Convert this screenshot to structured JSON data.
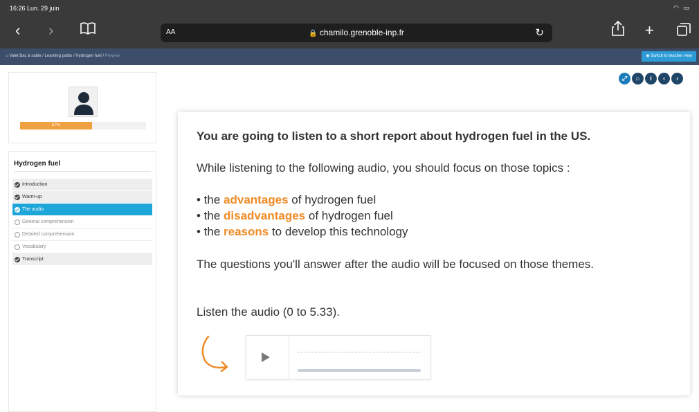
{
  "browser": {
    "status_time": "16:26  Lun. 29 juin",
    "address_aa": "AA",
    "url": "chamilo.grenoble-inp.fr"
  },
  "breadcrumb": {
    "items": [
      "Valet Bac à sable",
      "Learning paths",
      "Hydrogen fuel"
    ],
    "current": "Preview",
    "teacher_view_label": "Switch to teacher view"
  },
  "profile": {
    "progress_label": "57%",
    "progress_value": 0.57
  },
  "learning_path": {
    "title": "Hydrogen fuel",
    "items": [
      {
        "label": "Introduction",
        "state": "done"
      },
      {
        "label": "Warm-up",
        "state": "done"
      },
      {
        "label": "The audio",
        "state": "active"
      },
      {
        "label": "General comprehension",
        "state": "todo"
      },
      {
        "label": "Detailed comprehension",
        "state": "todo"
      },
      {
        "label": "Vocabulary",
        "state": "todo"
      },
      {
        "label": "Transcript",
        "state": "done"
      }
    ]
  },
  "nav_buttons": [
    "expand-icon",
    "home-icon",
    "info-icon",
    "previous-icon",
    "next-icon"
  ],
  "content": {
    "intro_title": "You are going to listen to a short report about hydrogen fuel in the US.",
    "focus_text": "While listening to the following audio, you should focus on those topics :",
    "topics": [
      {
        "prefix": "• the ",
        "keyword": "advantages",
        "suffix": " of hydrogen fuel"
      },
      {
        "prefix": "• the ",
        "keyword": "disadvantages",
        "suffix": " of hydrogen fuel"
      },
      {
        "prefix": "• the ",
        "keyword": "reasons",
        "suffix": " to develop this technology"
      }
    ],
    "questions_text": "The questions you'll answer after the audio will be focused on those themes.",
    "listen_text": "Listen the audio (0 to 5.33)."
  },
  "colors": {
    "accent_orange": "#f08b26",
    "active_blue": "#1ea6d8",
    "header_navy": "#3c4e6a"
  }
}
